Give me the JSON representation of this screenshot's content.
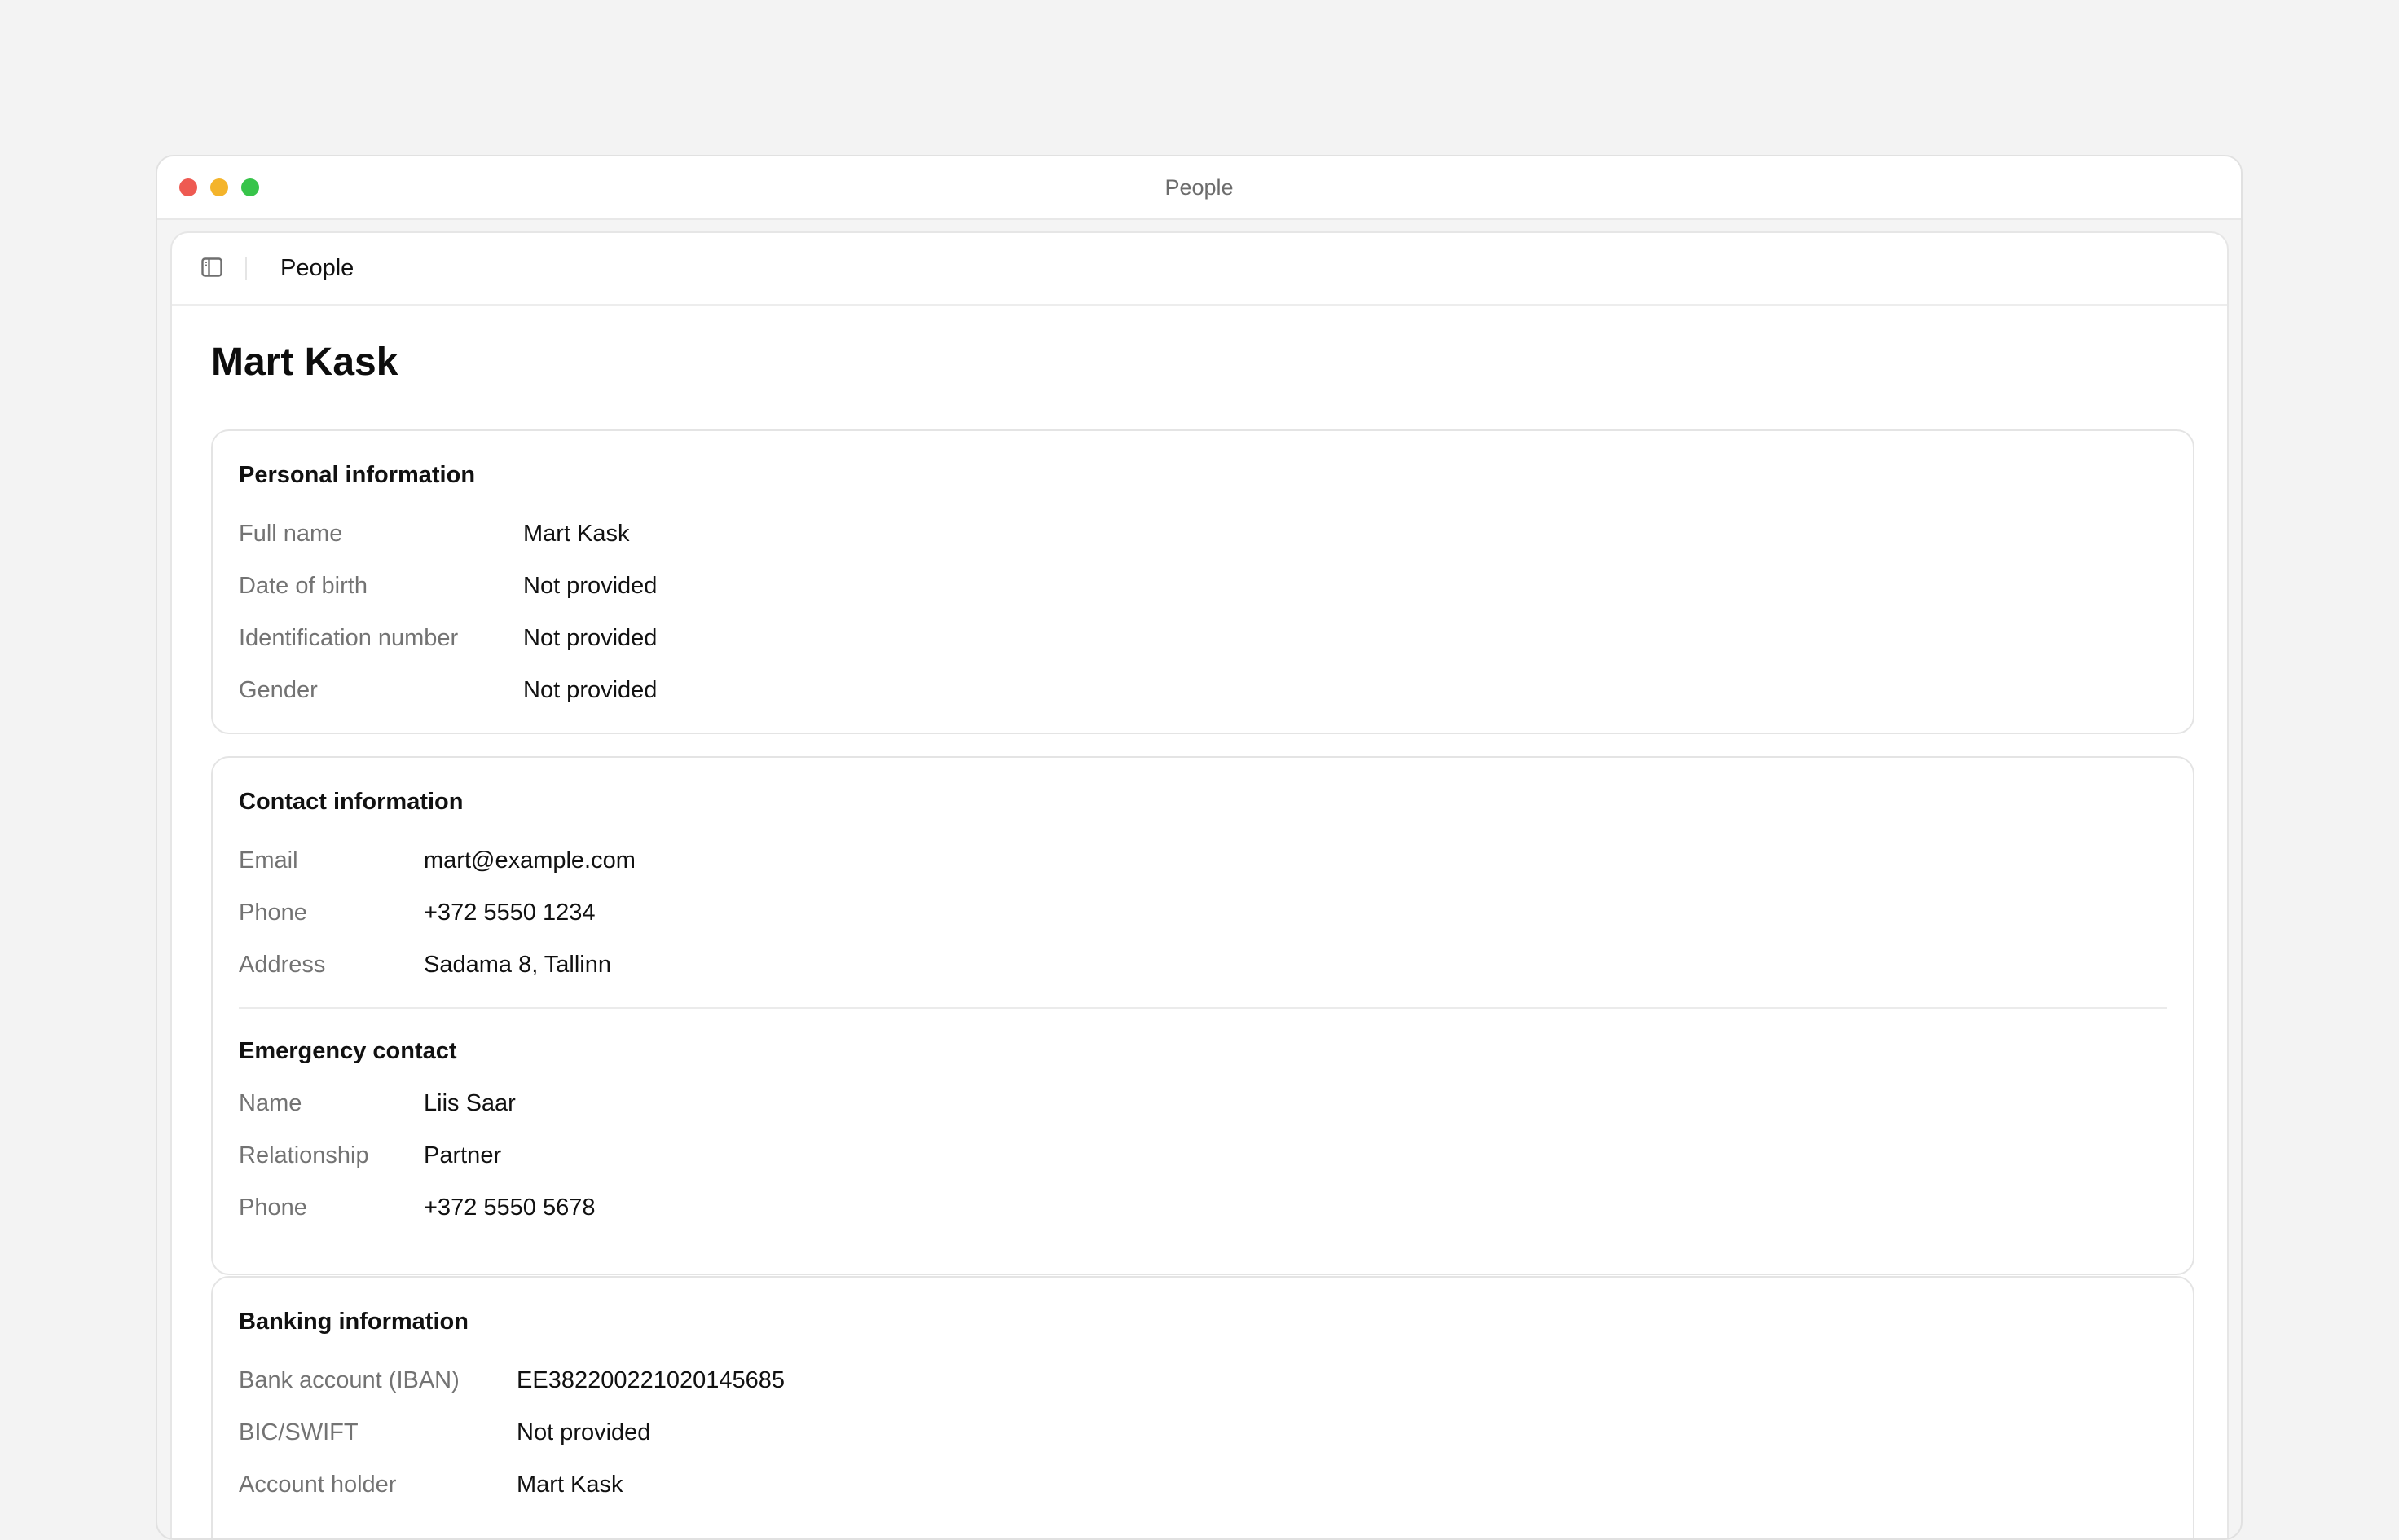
{
  "window": {
    "title": "People"
  },
  "toolbar": {
    "breadcrumb": "People"
  },
  "page": {
    "title": "Mart Kask"
  },
  "personal": {
    "title": "Personal information",
    "rows": [
      {
        "label": "Full name",
        "value": "Mart Kask"
      },
      {
        "label": "Date of birth",
        "value": "Not provided"
      },
      {
        "label": "Identification number",
        "value": "Not provided"
      },
      {
        "label": "Gender",
        "value": "Not provided"
      }
    ]
  },
  "contact": {
    "title": "Contact information",
    "rows": [
      {
        "label": "Email",
        "value": "mart@example.com"
      },
      {
        "label": "Phone",
        "value": "+372 5550 1234"
      },
      {
        "label": "Address",
        "value": "Sadama 8, Tallinn"
      }
    ]
  },
  "emergency": {
    "title": "Emergency contact",
    "rows": [
      {
        "label": "Name",
        "value": "Liis Saar"
      },
      {
        "label": "Relationship",
        "value": "Partner"
      },
      {
        "label": "Phone",
        "value": "+372 5550 5678"
      }
    ]
  },
  "banking": {
    "title": "Banking information",
    "rows": [
      {
        "label": "Bank account (IBAN)",
        "value": "EE382200221020145685"
      },
      {
        "label": "BIC/SWIFT",
        "value": "Not provided"
      },
      {
        "label": "Account holder",
        "value": "Mart Kask"
      }
    ]
  },
  "icons": {
    "sidebar_toggle": "sidebar-toggle-icon"
  },
  "colors": {
    "close": "#ee5a52",
    "minimize": "#f4b42b",
    "maximize": "#37c44a",
    "label_text": "#737373",
    "value_text": "#111111"
  }
}
